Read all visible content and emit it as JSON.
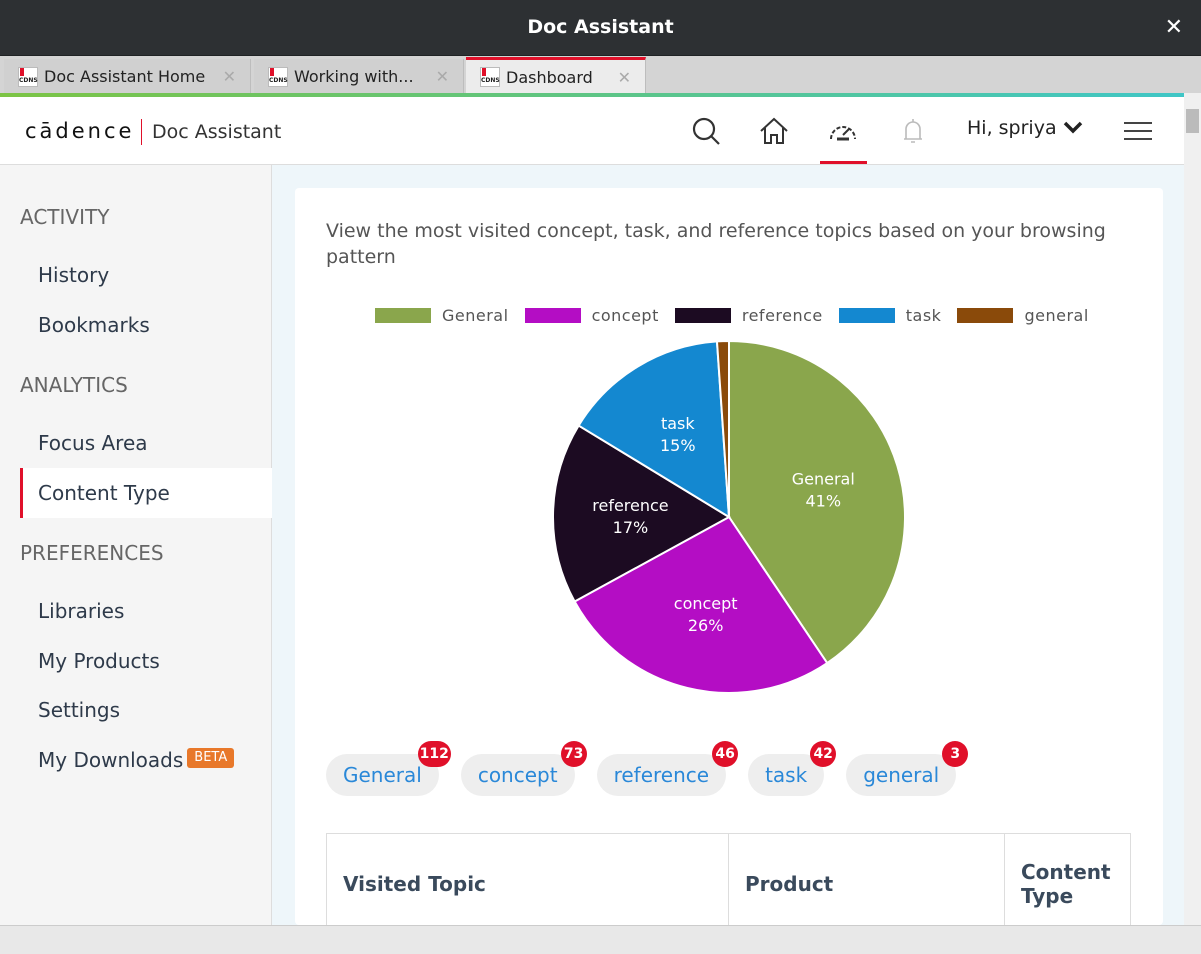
{
  "window": {
    "title": "Doc Assistant",
    "close": "✕"
  },
  "tabs": [
    {
      "label": "Doc Assistant Home",
      "favicon": "CDNS"
    },
    {
      "label": "Working with...",
      "favicon": "CDNS"
    },
    {
      "label": "Dashboard",
      "favicon": "CDNS",
      "active": true
    }
  ],
  "header": {
    "logo": "cādence",
    "app_name": "Doc Assistant",
    "user": "Hi, spriya",
    "icons": [
      "search-icon",
      "home-icon",
      "dashboard-icon",
      "bell-icon",
      "chevron-down-icon",
      "menu-icon"
    ]
  },
  "sidebar": {
    "sections": [
      {
        "title": "ACTIVITY",
        "items": [
          "History",
          "Bookmarks"
        ]
      },
      {
        "title": "ANALYTICS",
        "items": [
          "Focus Area",
          "Content Type"
        ]
      },
      {
        "title": "PREFERENCES",
        "items": [
          "Libraries",
          "My Products",
          "Settings",
          "My Downloads"
        ]
      }
    ],
    "beta": "BETA",
    "selected": "Content Type"
  },
  "main": {
    "description": "View the most visited concept, task, and reference topics based on your browsing pattern",
    "chips": [
      {
        "label": "General",
        "count": "112"
      },
      {
        "label": "concept",
        "count": "73"
      },
      {
        "label": "reference",
        "count": "46"
      },
      {
        "label": "task",
        "count": "42"
      },
      {
        "label": "general",
        "count": "3"
      }
    ],
    "table": {
      "headers": [
        "Visited Topic",
        "Product",
        "Content Type"
      ]
    }
  },
  "chart_data": {
    "type": "pie",
    "legend_position": "top",
    "categories": [
      "General",
      "concept",
      "reference",
      "task",
      "general"
    ],
    "values": [
      112,
      73,
      46,
      42,
      3
    ],
    "labels": [
      "41%",
      "26%",
      "17%",
      "15%",
      ""
    ],
    "colors": [
      "#8aa64c",
      "#b40dc4",
      "#1c0b22",
      "#1488d0",
      "#8a4a0a"
    ]
  },
  "colors": {
    "accent": "#e0102a",
    "chip_text": "#2a88d8",
    "beta": "#e8782a"
  }
}
